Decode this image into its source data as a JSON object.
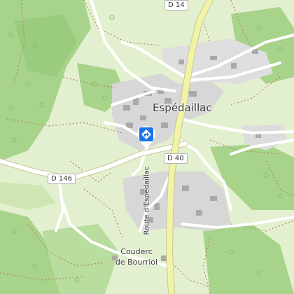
{
  "map": {
    "colors": {
      "background": "#e3f0cf",
      "forest": "#a7d38a",
      "scrub": "#cfe6b2",
      "village_area": "#d7d7d7",
      "building": "#a9a9a9",
      "road_casing": "#c8c79a",
      "road_fill": "#f3f3a6",
      "local_road": "#ffffff",
      "track": "#b18a5f",
      "poi_marker": "#1a73e8"
    },
    "places": {
      "village": "Espédaillac",
      "hamlet_line1": "Couderc",
      "hamlet_line2": "de Bourriol"
    },
    "roads": {
      "d14": "D 14",
      "d40": "D 40",
      "d146": "D 146",
      "route_name": "Route d'Espédaillac"
    },
    "poi": {
      "icon": "diamond-direction-icon"
    }
  }
}
